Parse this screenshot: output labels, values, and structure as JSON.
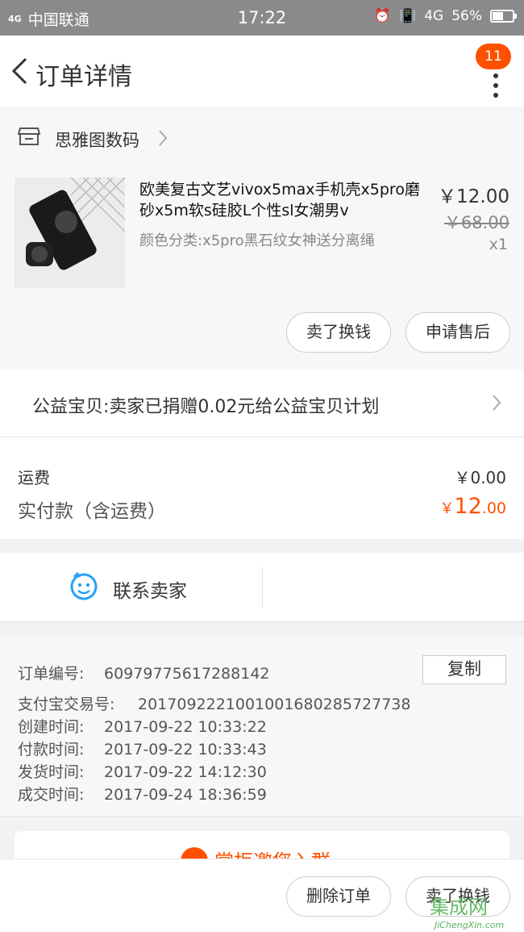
{
  "status_bar": {
    "signal": "4G",
    "carrier": "中国联通",
    "time": "17:22",
    "network": "4G",
    "battery": "56%",
    "battery_level": 0.56
  },
  "header": {
    "title": "订单详情",
    "badge_count": "11"
  },
  "shop": {
    "name": "思雅图数码"
  },
  "product": {
    "title": "欧美复古文艺vivox5max手机壳x5pro磨砂x5m软s硅胶L个性sl女潮男v",
    "sku": "颜色分类:x5pro黑石纹女神送分离绳",
    "price_now": "￥12.00",
    "price_old": "￥68.00",
    "quantity": "x1",
    "buttons": {
      "sell": "卖了换钱",
      "after_sale": "申请售后"
    }
  },
  "charity": {
    "text": "公益宝贝:卖家已捐赠0.02元给公益宝贝计划"
  },
  "fees": {
    "shipping_label": "运费",
    "shipping_value": "￥0.00",
    "paid_label": "实付款（含运费）",
    "paid_currency": "￥",
    "paid_int": "12",
    "paid_dec": ".00"
  },
  "contact": {
    "label": "联系卖家"
  },
  "order_info": {
    "order_no_label": "订单编号:",
    "order_no": "60979775617288142",
    "copy_label": "复制",
    "alipay_label": "支付宝交易号:",
    "alipay_no": "2017092221001001680285727738",
    "created_label": "创建时间:",
    "created": "2017-09-22 10:33:22",
    "paid_label": "付款时间:",
    "paid": "2017-09-22 10:33:43",
    "shipped_label": "发货时间:",
    "shipped": "2017-09-22 14:12:30",
    "done_label": "成交时间:",
    "done": "2017-09-24 18:36:59"
  },
  "promo": {
    "text": "掌柜邀您入群"
  },
  "bottom_bar": {
    "delete": "删除订单",
    "sell": "卖了换钱"
  },
  "watermark": {
    "cn": "集成网",
    "en": "JiChengXin.com"
  },
  "colors": {
    "accent": "#ff5000",
    "contact_icon": "#29a1f7"
  }
}
